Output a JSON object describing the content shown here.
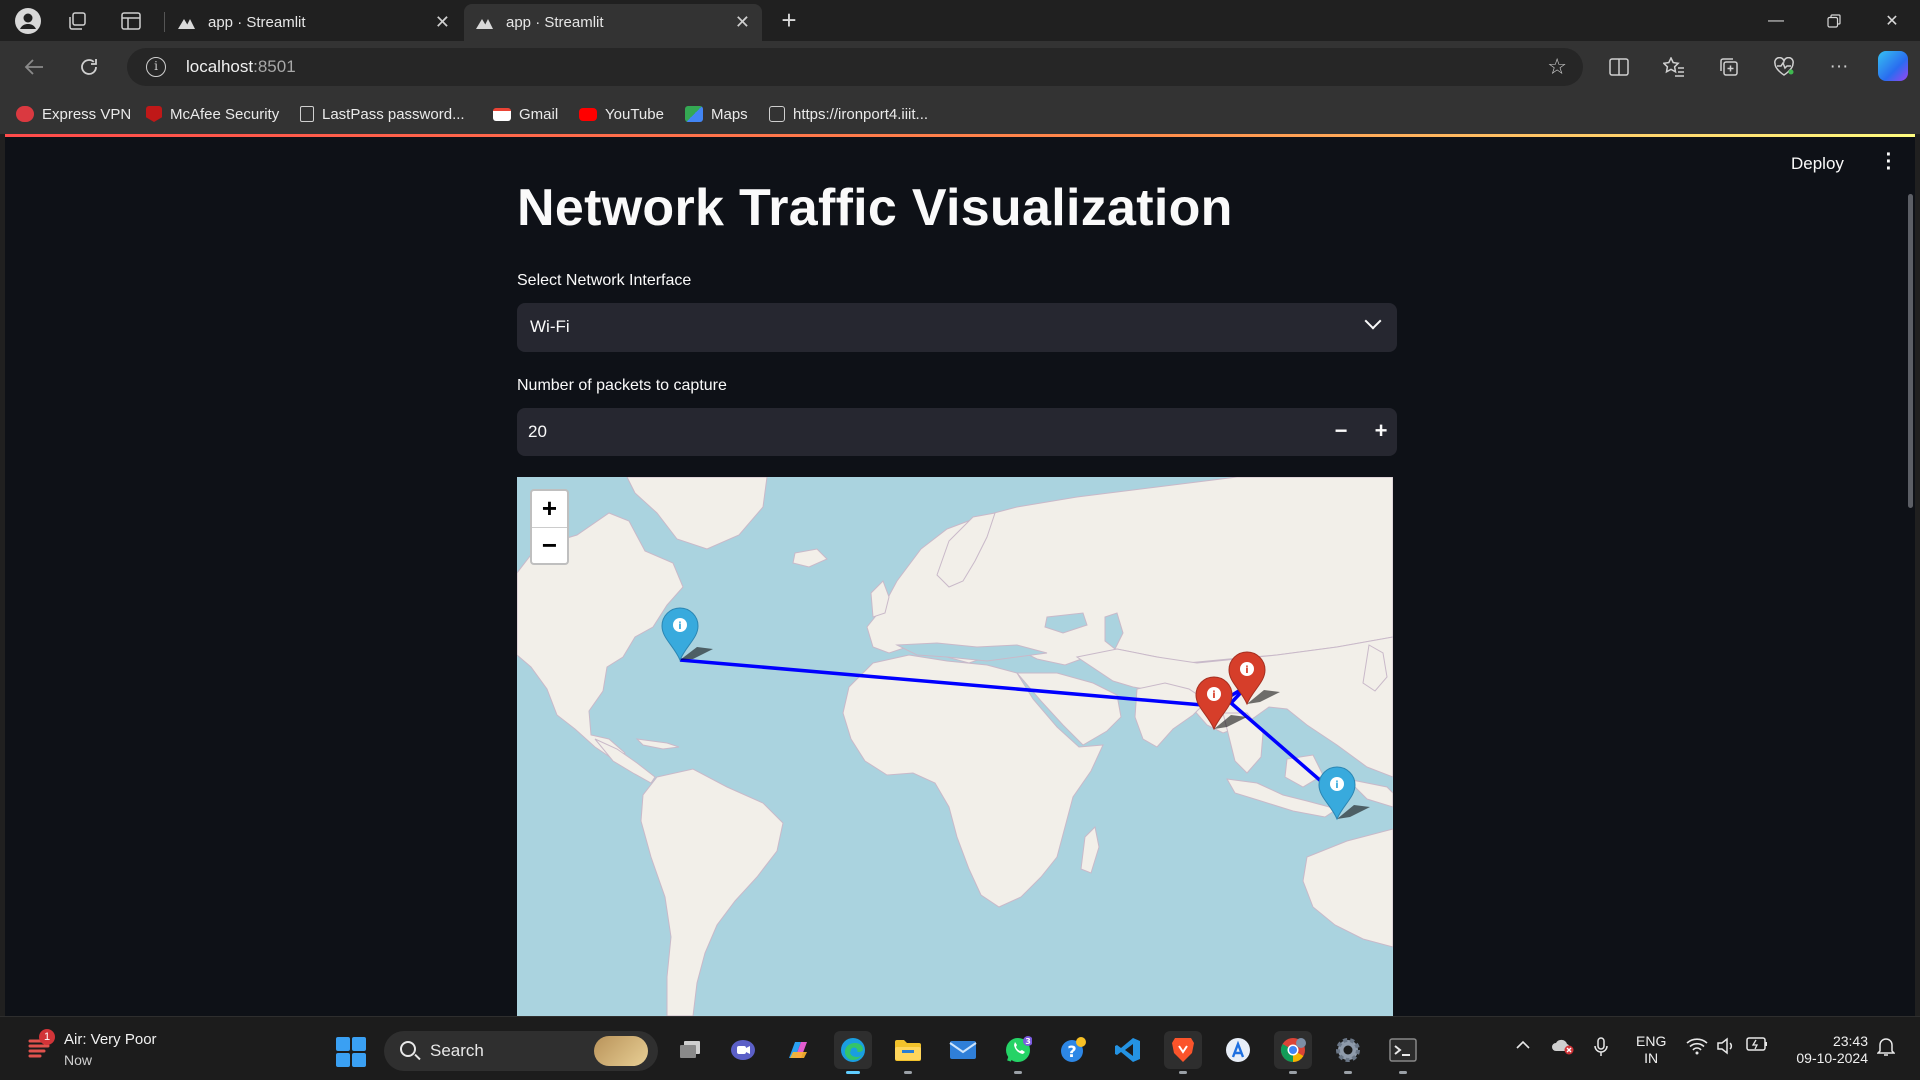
{
  "browser": {
    "tabs": [
      {
        "title": "app · Streamlit",
        "active": false
      },
      {
        "title": "app · Streamlit",
        "active": true
      }
    ],
    "address": {
      "host": "localhost",
      "port": ":8501"
    },
    "favorites": [
      {
        "label": "Express VPN",
        "icon": "expressvpn-icon",
        "color": "#da3940"
      },
      {
        "label": "McAfee Security",
        "icon": "mcafee-icon",
        "color": "#c01818"
      },
      {
        "label": "LastPass password...",
        "icon": "document-icon",
        "color": "#cfcfcf"
      },
      {
        "label": "Gmail",
        "icon": "gmail-icon",
        "color": "#ea4335"
      },
      {
        "label": "YouTube",
        "icon": "youtube-icon",
        "color": "#ff0000"
      },
      {
        "label": "Maps",
        "icon": "maps-icon",
        "color": "#34a853"
      },
      {
        "label": "https://ironport4.iiit...",
        "icon": "web-page-icon",
        "color": "#cfcfcf"
      }
    ]
  },
  "app": {
    "deploy_label": "Deploy",
    "title": "Network Traffic Visualization",
    "interface": {
      "label": "Select Network Interface",
      "value": "Wi-Fi"
    },
    "packets": {
      "label": "Number of packets to capture",
      "value": "20",
      "minus": "−",
      "plus": "+"
    },
    "map": {
      "zoom_in": "+",
      "zoom_out": "−",
      "markers": [
        {
          "location": "United States east coast",
          "color": "#38aadd"
        },
        {
          "location": "Western India",
          "color": "#d63e2a"
        },
        {
          "location": "Eastern India",
          "color": "#d63e2a"
        },
        {
          "location": "Indonesia",
          "color": "#38aadd"
        }
      ],
      "route_color": "#0000ff"
    }
  },
  "taskbar": {
    "weather": {
      "title": "Air: Very Poor",
      "subtitle": "Now",
      "badge": "1"
    },
    "search_label": "Search",
    "apps": [
      {
        "name": "task-view-icon"
      },
      {
        "name": "meet-icon"
      },
      {
        "name": "copilot-icon"
      },
      {
        "name": "edge-icon"
      },
      {
        "name": "file-explorer-icon"
      },
      {
        "name": "mail-icon"
      },
      {
        "name": "whatsapp-icon",
        "badge": "3"
      },
      {
        "name": "help-icon"
      },
      {
        "name": "vscode-icon"
      },
      {
        "name": "brave-icon"
      },
      {
        "name": "app-store-icon"
      },
      {
        "name": "chrome-icon"
      },
      {
        "name": "settings-icon"
      },
      {
        "name": "terminal-icon"
      }
    ],
    "lang": {
      "line1": "ENG",
      "line2": "IN"
    },
    "time": "23:43",
    "date": "09-10-2024"
  }
}
